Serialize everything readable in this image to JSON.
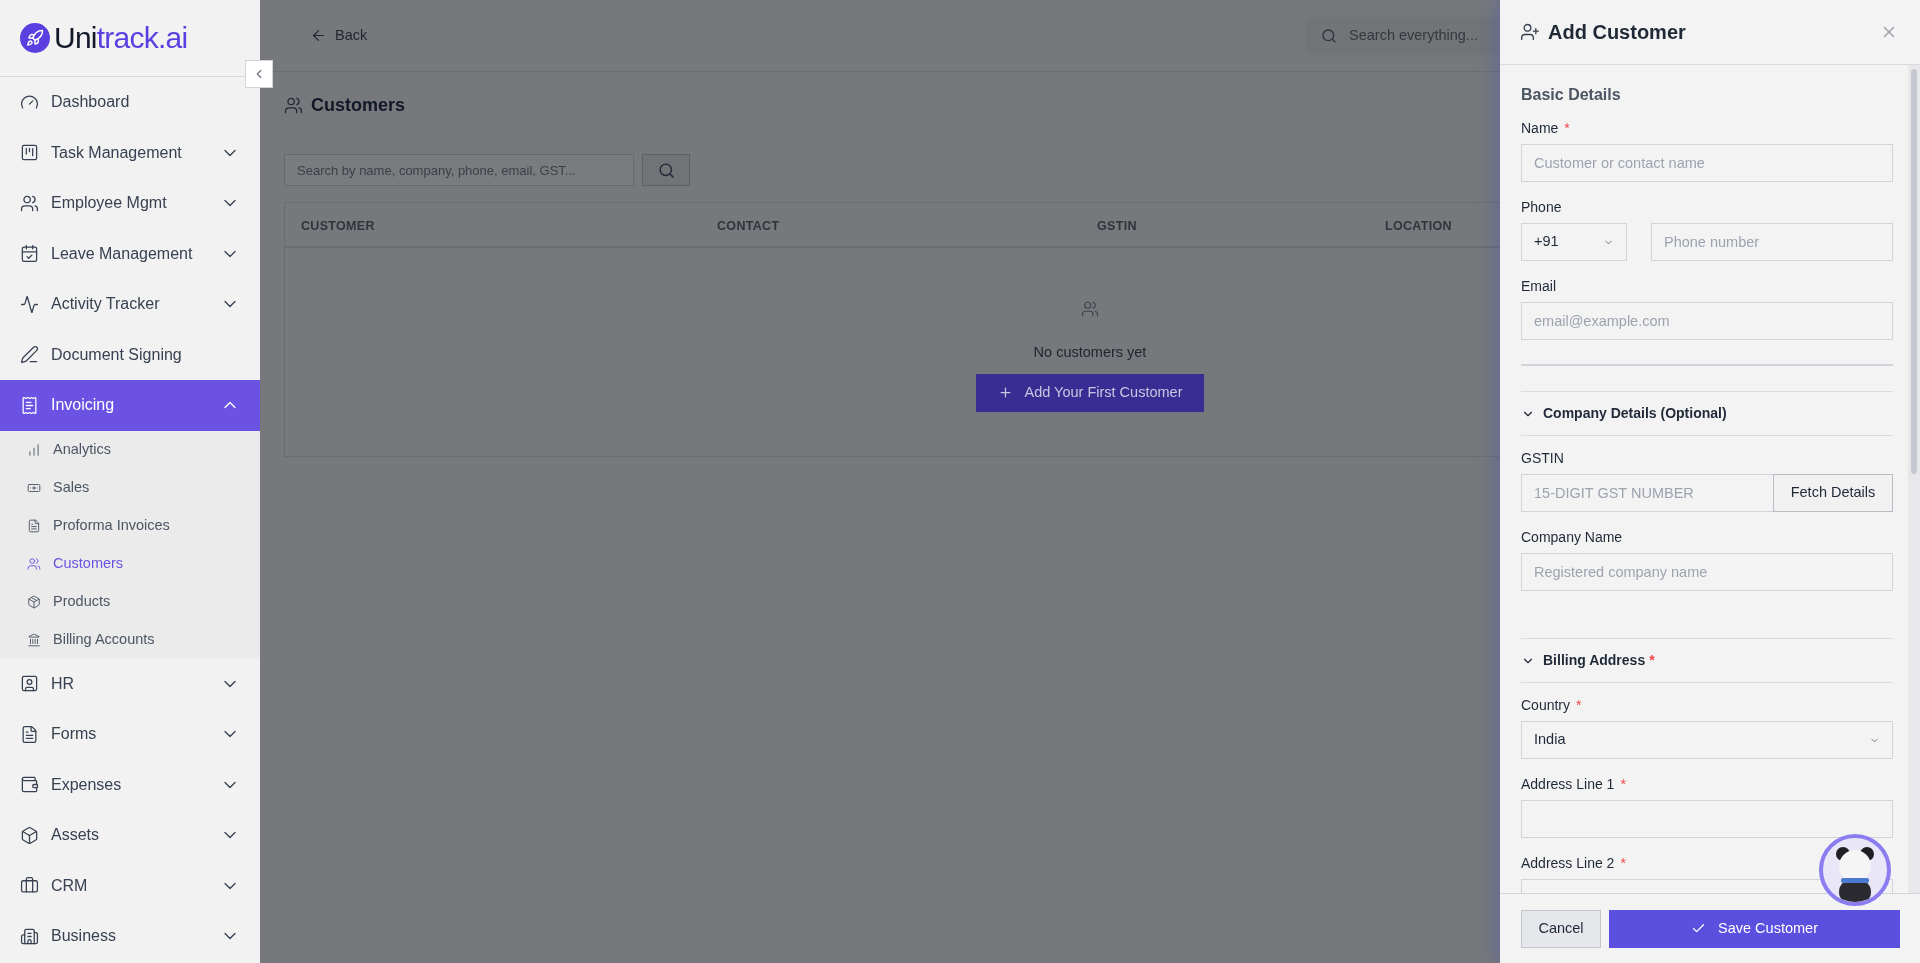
{
  "logo": {
    "prefix": "Uni",
    "suffix": "track.ai"
  },
  "sidebar": {
    "items": [
      {
        "label": "Dashboard",
        "selected": false
      },
      {
        "label": "Task Management",
        "selected": false,
        "expanded": false
      },
      {
        "label": "Employee Mgmt",
        "selected": false,
        "expanded": false
      },
      {
        "label": "Leave Management",
        "selected": false,
        "expanded": false
      },
      {
        "label": "Activity Tracker",
        "selected": false,
        "expanded": false
      },
      {
        "label": "Document Signing",
        "selected": false
      },
      {
        "label": "Invoicing",
        "selected": true,
        "expanded": true,
        "children": [
          {
            "label": "Analytics",
            "selected": false
          },
          {
            "label": "Sales",
            "selected": false
          },
          {
            "label": "Proforma Invoices",
            "selected": false
          },
          {
            "label": "Customers",
            "selected": true
          },
          {
            "label": "Products",
            "selected": false
          },
          {
            "label": "Billing Accounts",
            "selected": false
          }
        ]
      },
      {
        "label": "HR",
        "selected": false,
        "expanded": false
      },
      {
        "label": "Forms",
        "selected": false,
        "expanded": false
      },
      {
        "label": "Expenses",
        "selected": false,
        "expanded": false
      },
      {
        "label": "Assets",
        "selected": false,
        "expanded": false
      },
      {
        "label": "CRM",
        "selected": false,
        "expanded": false
      },
      {
        "label": "Business",
        "selected": false,
        "expanded": false
      }
    ]
  },
  "topbar": {
    "back": "Back",
    "search": {
      "placeholder": "Search everything..."
    }
  },
  "page": {
    "title": "Customers",
    "search": {
      "placeholder": "Search by name, company, phone, email, GST..."
    },
    "table": {
      "columns": [
        "CUSTOMER",
        "CONTACT",
        "GSTIN",
        "LOCATION"
      ],
      "empty": {
        "message": "No customers yet",
        "button": "Add Your First Customer"
      }
    }
  },
  "drawer": {
    "title": "Add Customer",
    "blocks": [
      {
        "kind": "heading",
        "label": "Basic Details"
      },
      {
        "kind": "text_field",
        "label": "Name",
        "required_mark": "*",
        "placeholder": "Customer or contact name"
      },
      {
        "kind": "phone_field",
        "label": "Phone",
        "code": "+91",
        "placeholder": "Phone number"
      },
      {
        "kind": "text_field",
        "label": "Email",
        "placeholder": "email@example.com"
      },
      {
        "kind": "rule"
      },
      {
        "kind": "section_toggle",
        "label": "Company Details (Optional)",
        "expanded": true
      },
      {
        "kind": "button_field",
        "label": "GSTIN",
        "placeholder": "15-DIGIT GST NUMBER",
        "button": "Fetch Details"
      },
      {
        "kind": "text_field",
        "label": "Company Name",
        "placeholder": "Registered company name"
      },
      {
        "kind": "section_toggle",
        "label": "Billing Address",
        "required_mark": "*",
        "expanded": true
      },
      {
        "kind": "select_field",
        "label": "Country",
        "required_mark": "*",
        "value": "India"
      },
      {
        "kind": "text_field",
        "label": "Address Line 1",
        "required_mark": "*"
      },
      {
        "kind": "text_field",
        "label": "Address Line 2",
        "required_mark": "*"
      }
    ],
    "buttons": {
      "cancel": "Cancel",
      "save": "Save Customer"
    }
  }
}
